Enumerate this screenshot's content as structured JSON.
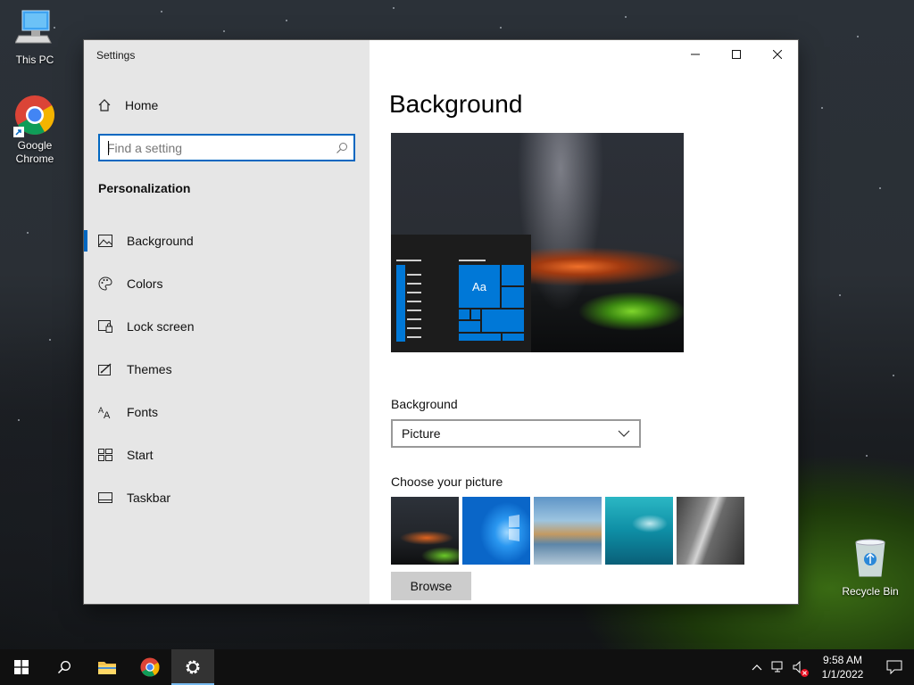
{
  "desktop": {
    "icons": [
      {
        "label": "This PC"
      },
      {
        "label": "Google Chrome"
      },
      {
        "label": "Recycle Bin"
      }
    ]
  },
  "window": {
    "title": "Settings",
    "sidebar": {
      "home_label": "Home",
      "search_placeholder": "Find a setting",
      "section": "Personalization",
      "items": [
        {
          "label": "Background",
          "icon": "picture-icon",
          "active": true
        },
        {
          "label": "Colors",
          "icon": "palette-icon"
        },
        {
          "label": "Lock screen",
          "icon": "lock-screen-icon"
        },
        {
          "label": "Themes",
          "icon": "themes-icon"
        },
        {
          "label": "Fonts",
          "icon": "fonts-icon"
        },
        {
          "label": "Start",
          "icon": "start-icon"
        },
        {
          "label": "Taskbar",
          "icon": "taskbar-icon"
        }
      ]
    },
    "main": {
      "title": "Background",
      "preview_tile_text": "Aa",
      "background_label": "Background",
      "background_value": "Picture",
      "choose_picture_label": "Choose your picture",
      "browse_label": "Browse"
    }
  },
  "taskbar": {
    "time": "9:58 AM",
    "date": "1/1/2022"
  },
  "colors": {
    "accent": "#0078d7",
    "focus_border": "#0067c0"
  }
}
